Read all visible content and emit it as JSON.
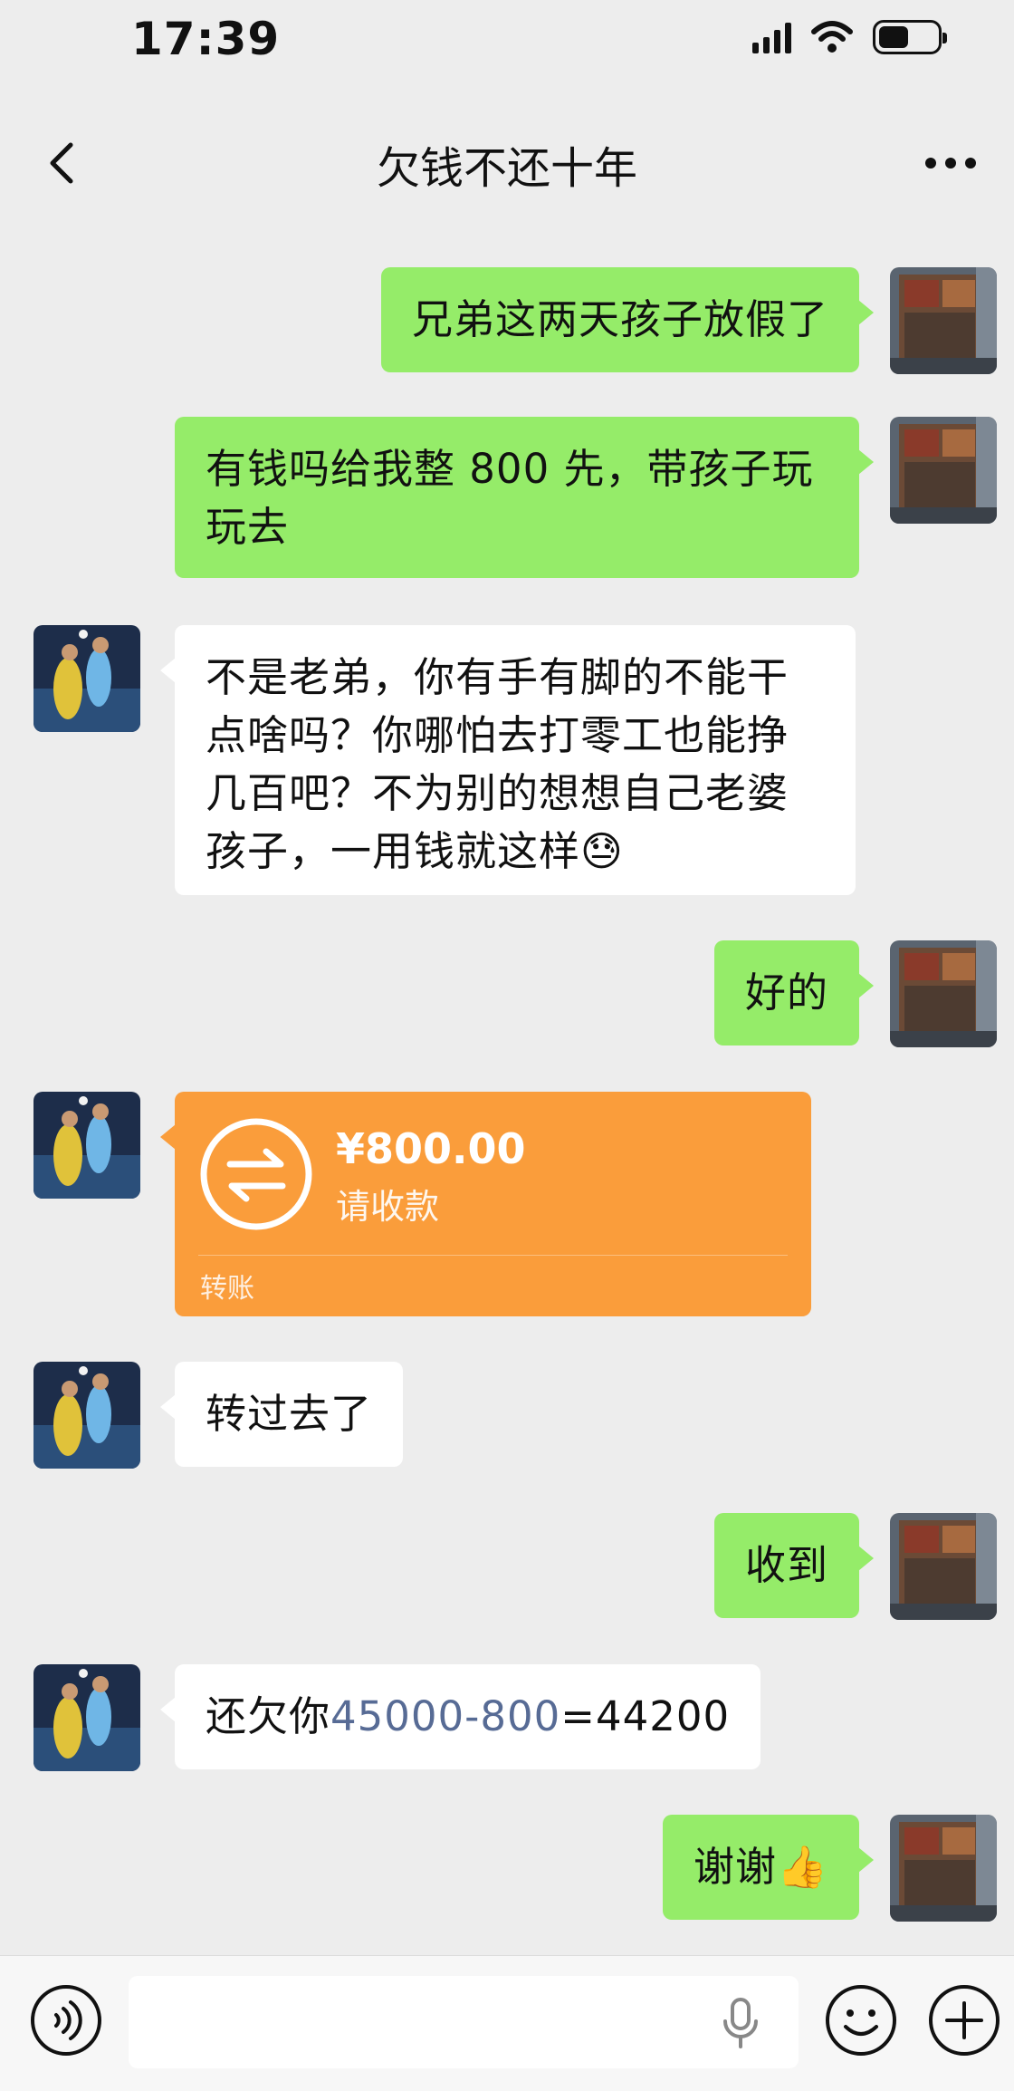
{
  "status_bar": {
    "time": "17:39"
  },
  "header": {
    "title": "欠钱不还十年"
  },
  "messages": {
    "m1": "兄弟这两天孩子放假了",
    "m2": "有钱吗给我整 800 先，带孩子玩玩去",
    "m3": "不是老弟，你有手有脚的不能干点啥吗？你哪怕去打零工也能挣几百吧？不为别的想想自己老婆孩子，一用钱就这样",
    "m3_emoji": "😓",
    "m4": "好的",
    "transfer": {
      "amount": "¥800.00",
      "status": "请收款",
      "label": "转账"
    },
    "m6": "转过去了",
    "m7": "收到",
    "m8_prefix": "还欠你",
    "m8_calc": "45000-800",
    "m8_result": "=44200",
    "m9": "谢谢",
    "m9_emoji": "👍"
  },
  "input_bar": {
    "placeholder": ""
  },
  "colors": {
    "self_bubble": "#95ec69",
    "other_bubble": "#ffffff",
    "transfer": "#fa9d3b",
    "background": "#ededed"
  },
  "icons": [
    "back-icon",
    "more-icon",
    "voice-icon",
    "mic-icon",
    "emoji-icon",
    "plus-icon",
    "transfer-icon"
  ]
}
